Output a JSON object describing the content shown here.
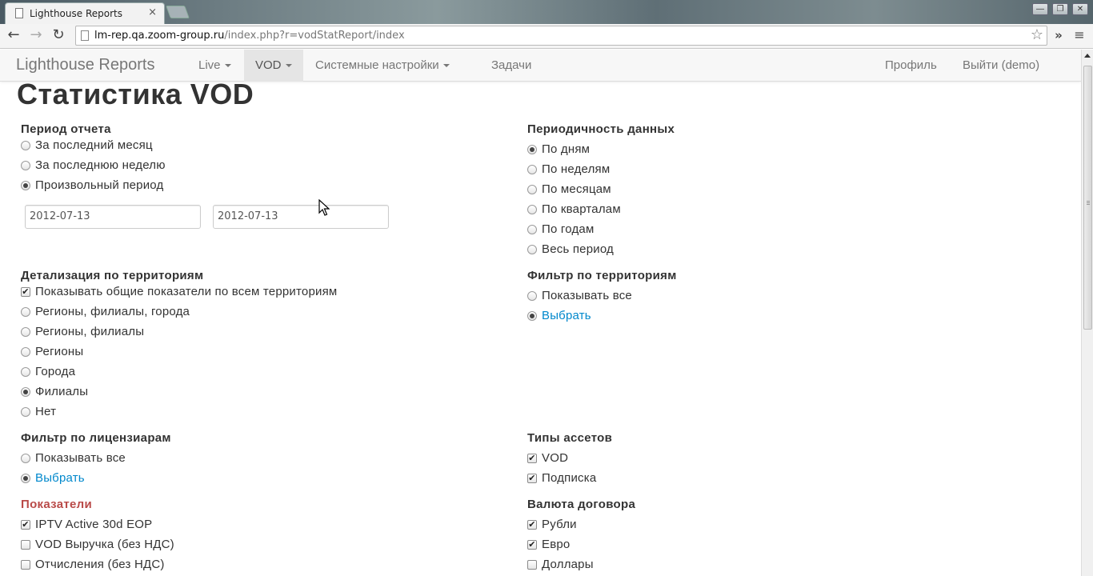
{
  "browser": {
    "tab_title": "Lighthouse Reports",
    "tab_close": "×",
    "url_host": "lm-rep.qa.zoom-group.ru",
    "url_path": "/index.php?r=vodStatReport/index",
    "window_buttons": [
      "—",
      "❐",
      "✕"
    ],
    "icons": [
      "back-arrow-icon",
      "forward-arrow-icon",
      "reload-icon",
      "star-icon",
      "extensions-chevron-icon",
      "wrench-menu-icon"
    ]
  },
  "navbar": {
    "brand": "Lighthouse Reports",
    "items": [
      {
        "label": "Live",
        "dropdown": true
      },
      {
        "label": "VOD",
        "dropdown": true,
        "active": true
      },
      {
        "label": "Системные настройки",
        "dropdown": true
      },
      {
        "label": "Задачи",
        "dropdown": false
      }
    ],
    "profile": "Профиль",
    "logout": "Выйти (demo)"
  },
  "page": {
    "title": "Статистика VOD",
    "report_period": {
      "label": "Период отчета",
      "options": [
        "За последний месяц",
        "За последнюю неделю",
        "Произвольный период"
      ],
      "selected": "Произвольный период",
      "date_from": "2012-07-13",
      "date_to": "2012-07-13"
    },
    "periodicity": {
      "label": "Периодичность данных",
      "options": [
        "По дням",
        "По неделям",
        "По месяцам",
        "По кварталам",
        "По годам",
        "Весь период"
      ],
      "selected": "По дням"
    },
    "territory_detail": {
      "label": "Детализация по территориям",
      "checkbox": "Показывать общие показатели по всем территориям",
      "options": [
        "Регионы, филиалы, города",
        "Регионы, филиалы",
        "Регионы",
        "Города",
        "Филиалы",
        "Нет"
      ],
      "selected": "Филиалы"
    },
    "territory_filter": {
      "label": "Фильтр по территориям",
      "options": [
        "Показывать все",
        "Выбрать"
      ],
      "selected": "Выбрать"
    },
    "licensor_filter": {
      "label": "Фильтр по лицензиарам",
      "options": [
        "Показывать все",
        "Выбрать"
      ],
      "selected": "Выбрать"
    },
    "asset_types": {
      "label": "Типы ассетов",
      "options": [
        "VOD",
        "Подписка"
      ],
      "checked": [
        true,
        true
      ]
    },
    "indicators": {
      "label": "Показатели",
      "options": [
        "IPTV Active 30d EOP",
        "VOD Выручка (без НДС)",
        "Отчисления (без НДС)"
      ],
      "checked": [
        true,
        false,
        false
      ]
    },
    "currency": {
      "label": "Валюта договора",
      "options": [
        "Рубли",
        "Евро",
        "Доллары"
      ],
      "checked": [
        true,
        true,
        false
      ]
    }
  }
}
